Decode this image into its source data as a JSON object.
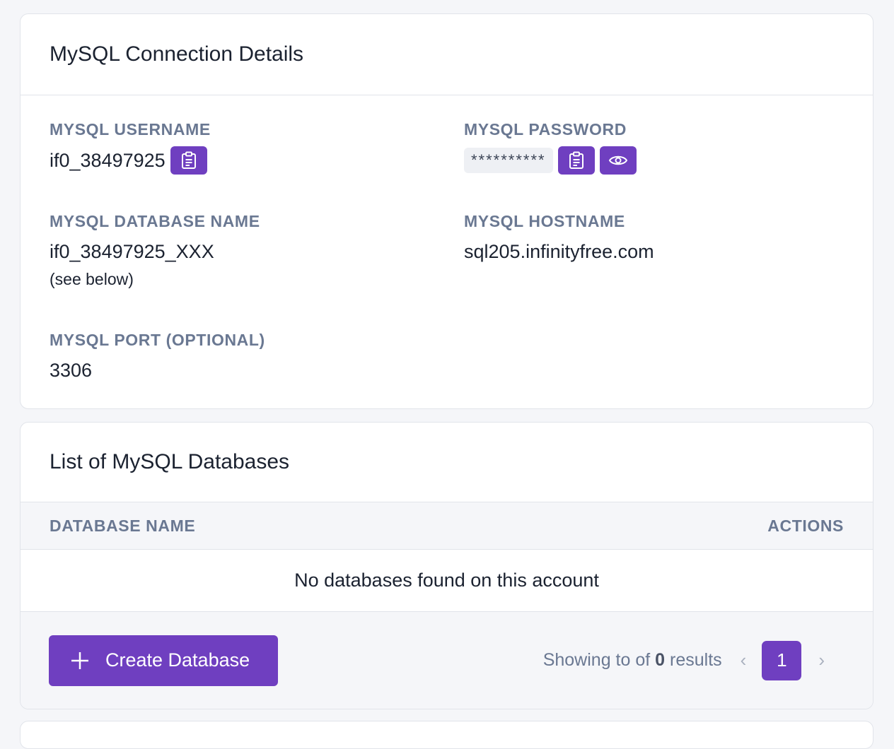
{
  "connection": {
    "title": "MySQL Connection Details",
    "username": {
      "label": "MYSQL USERNAME",
      "value": "if0_38497925"
    },
    "password": {
      "label": "MYSQL PASSWORD",
      "masked": "**********"
    },
    "database_name": {
      "label": "MYSQL DATABASE NAME",
      "value": "if0_38497925_XXX",
      "note": "(see below)"
    },
    "hostname": {
      "label": "MYSQL HOSTNAME",
      "value": "sql205.infinityfree.com"
    },
    "port": {
      "label": "MYSQL PORT (OPTIONAL)",
      "value": "3306"
    }
  },
  "databases": {
    "title": "List of MySQL Databases",
    "columns": [
      "DATABASE NAME",
      "ACTIONS"
    ],
    "empty_message": "No databases found on this account",
    "create_button_label": "Create Database",
    "pagination": {
      "text_before": "Showing to of",
      "total": "0",
      "text_after": "results",
      "prev": "‹",
      "current_page": "1",
      "next": "›"
    }
  },
  "colors": {
    "accent": "#6f3fc0",
    "label": "#6a7892",
    "background": "#f5f6f9"
  },
  "icons": {
    "copy": "clipboard-icon",
    "reveal": "eye-icon",
    "add": "plus-icon"
  }
}
